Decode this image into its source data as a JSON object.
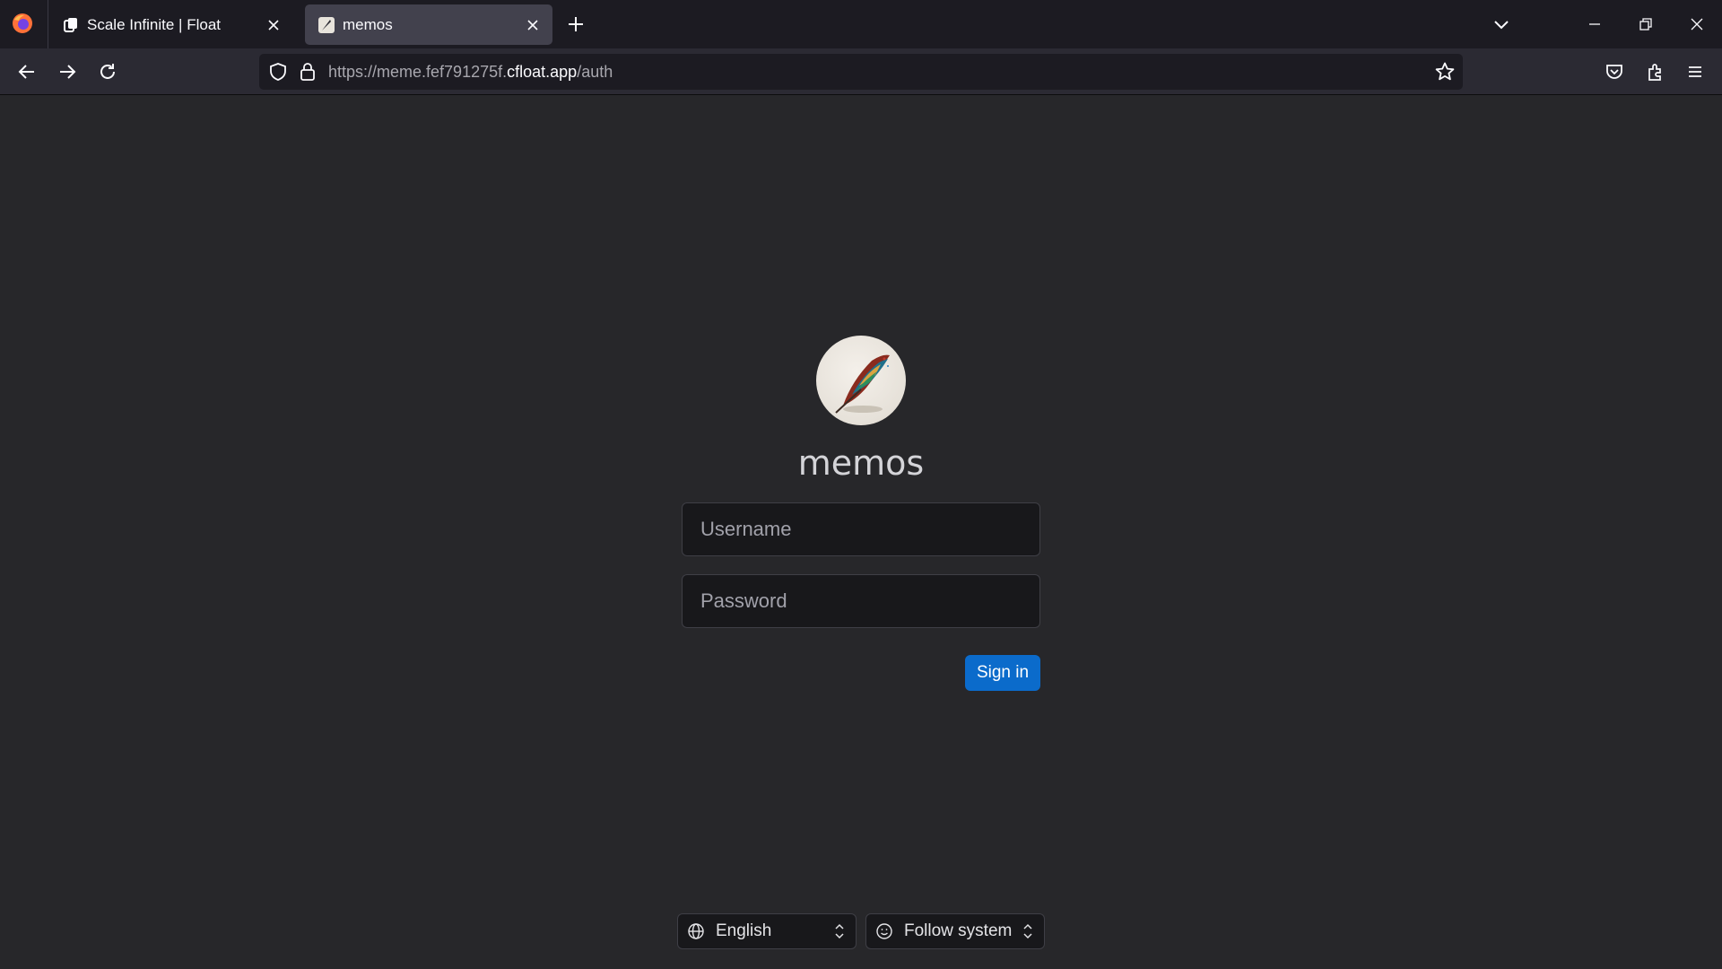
{
  "browser": {
    "tabs": [
      {
        "title": "Scale Infinite | Float",
        "active": false
      },
      {
        "title": "memos",
        "active": true
      }
    ],
    "url": {
      "prefix": "https://meme.fef791275f.",
      "domain": "cfloat.app",
      "path": "/auth"
    }
  },
  "auth": {
    "app_name": "memos",
    "username_placeholder": "Username",
    "password_placeholder": "Password",
    "signin_label": "Sign in"
  },
  "footer": {
    "language": "English",
    "theme": "Follow system"
  },
  "colors": {
    "accent": "#0b6bcb",
    "page_bg": "#27272a",
    "input_bg": "#18181b"
  },
  "icons": [
    "firefox-logo-icon",
    "float-favicon-icon",
    "memos-favicon-icon",
    "close-icon",
    "plus-icon",
    "chevron-down-icon",
    "minimize-icon",
    "restore-icon",
    "back-icon",
    "forward-icon",
    "reload-icon",
    "shield-icon",
    "lock-icon",
    "star-icon",
    "pocket-icon",
    "extensions-icon",
    "menu-icon",
    "globe-icon",
    "smiley-icon",
    "updown-icon"
  ]
}
